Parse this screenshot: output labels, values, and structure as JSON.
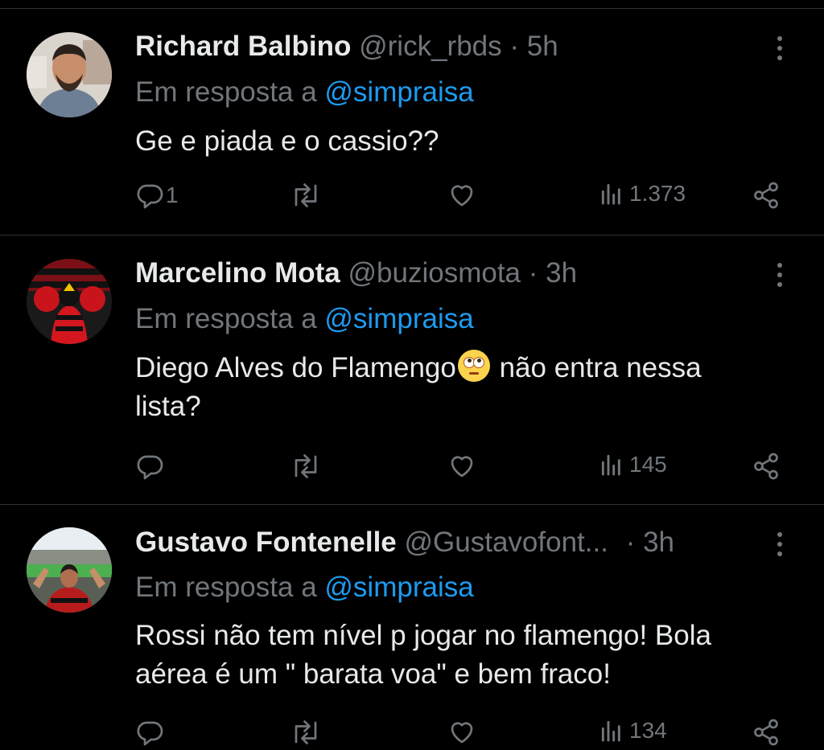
{
  "tweets": [
    {
      "name": "Richard Balbino",
      "handle": "@rick_rbds",
      "dot": "·",
      "time": "5h",
      "reply_prefix": "Em resposta a",
      "reply_handle": "@simpraisa",
      "text_lines": [
        "Ge e  piada e o cassio??"
      ],
      "reply_count": "1",
      "views": "1.373"
    },
    {
      "name": "Marcelino Mota",
      "handle": "@buziosmota",
      "dot": "·",
      "time": "3h",
      "reply_prefix": "Em resposta a",
      "reply_handle": "@simpraisa",
      "text_before_emoji": "Diego Alves do Flamengo",
      "emoji": "rolling-eyes-emoji",
      "text_after_emoji": " não entra nessa",
      "text_line2": "lista?",
      "reply_count": "",
      "views": "145"
    },
    {
      "name": "Gustavo Fontenelle",
      "handle": "@Gustavofont...",
      "dot": "·",
      "time": "3h",
      "reply_prefix": "Em resposta a",
      "reply_handle": "@simpraisa",
      "text_lines": [
        "Rossi não tem nível p jogar no flamengo! Bola",
        "aérea é um \" barata voa\" e bem fraco!"
      ],
      "reply_count": "",
      "views": "134"
    }
  ],
  "colors": {
    "background": "#000000",
    "text": "#e7e9ea",
    "muted": "#71767b",
    "link": "#1d9bf0",
    "divider": "#2f3336"
  }
}
